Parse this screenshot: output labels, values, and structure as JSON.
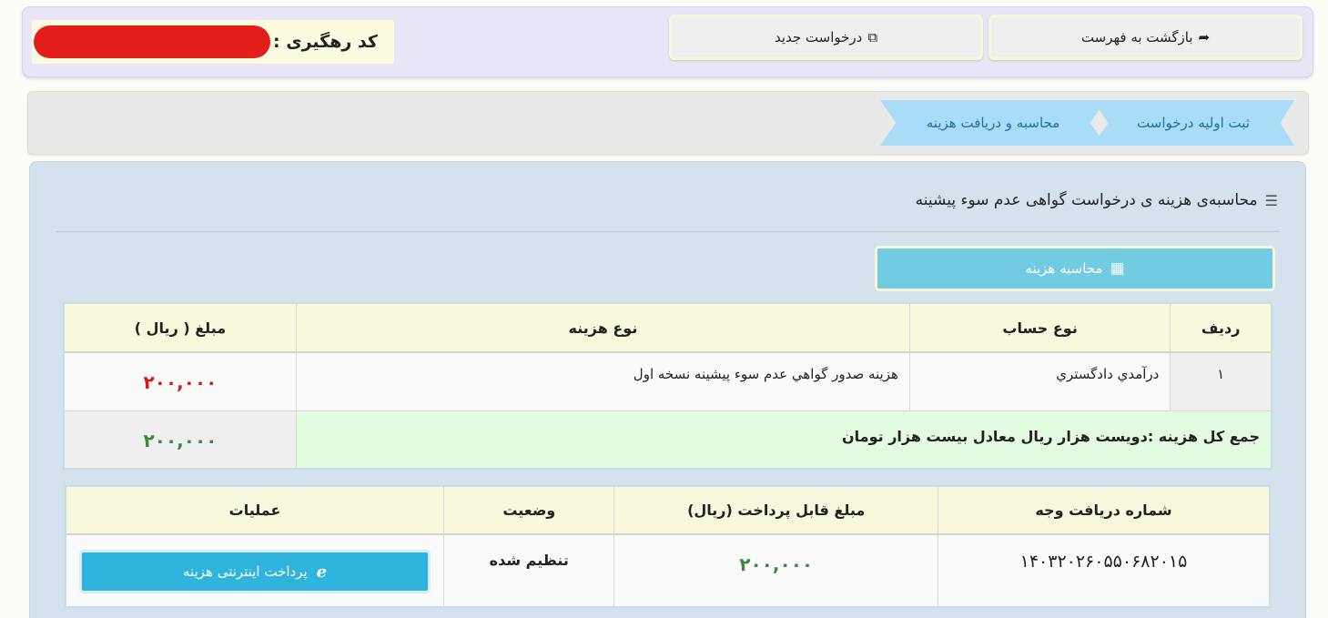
{
  "header": {
    "back_button": {
      "label": "بازگشت به فهرست",
      "icon": "share-arrow-icon"
    },
    "new_request_button": {
      "label": "درخواست جدید",
      "icon": "external-link-icon"
    },
    "tracking": {
      "label": "کد رهگیری :",
      "value_redacted": true
    }
  },
  "breadcrumb": {
    "steps": [
      {
        "label": "ثبت اولیه درخواست"
      },
      {
        "label": "محاسبه و دریافت هزینه"
      }
    ]
  },
  "panel": {
    "title": "محاسبه‌ی هزینه ی درخواست گواهی عدم سوء پیشینه",
    "title_icon": "list-icon",
    "calc_button": {
      "label": "محاسبه هزینه",
      "icon": "calculator-icon"
    }
  },
  "cost_table": {
    "headers": {
      "row": "ردیف",
      "account_type": "نوع حساب",
      "cost_type": "نوع هزینه",
      "amount": "مبلغ ( ریال )"
    },
    "rows": [
      {
        "row": "۱",
        "account_type": "درآمدي دادگستري",
        "cost_type": "هزينه صدور گواهي عدم سوء پيشينه نسخه اول",
        "amount": "۲۰۰,۰۰۰"
      }
    ],
    "total_label": "جمع کل هزینه :دویست هزار ریال معادل بیست هزار تومان",
    "total_amount": "۲۰۰,۰۰۰"
  },
  "payment_table": {
    "headers": {
      "receipt_number": "شماره دریافت وجه",
      "payable_amount": "مبلغ قابل پرداخت (ریال)",
      "status": "وضعیت",
      "operations": "عملیات"
    },
    "rows": [
      {
        "receipt_number": "۱۴۰۳۲۰۲۶۰۵۵۰۶۸۲۰۱۵",
        "payable_amount": "۲۰۰,۰۰۰",
        "status": "تنظیم شده",
        "pay_button": "پرداخت اینترنتی هزینه"
      }
    ]
  },
  "colors": {
    "amount_red": "#d31c1c",
    "amount_green": "#3a8a3a",
    "breadcrumb_bg": "#a9dcf7",
    "pay_button": "#2fb4dd",
    "calc_button": "#72cbe0"
  }
}
